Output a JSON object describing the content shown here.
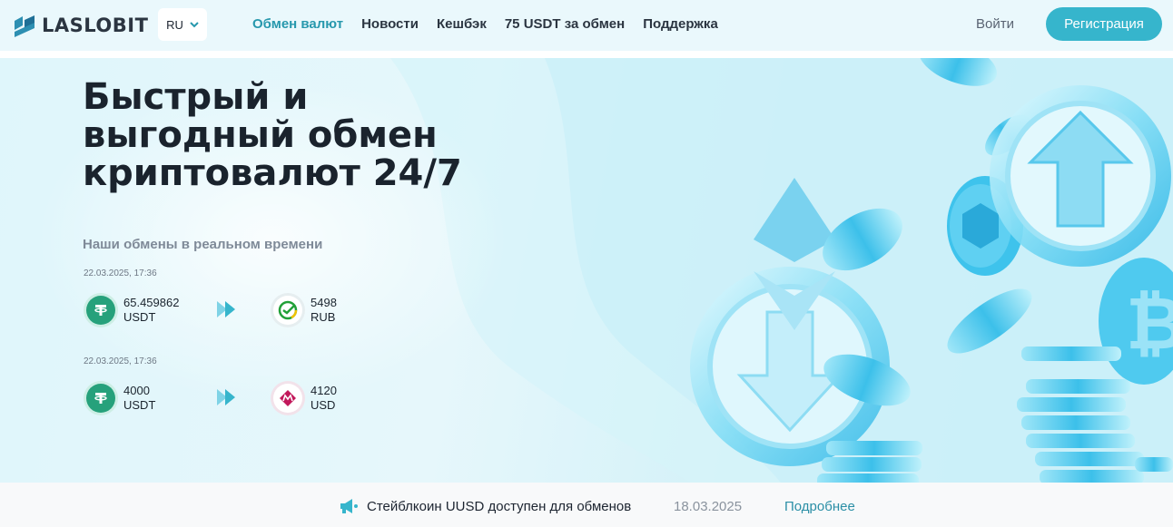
{
  "brand": {
    "name": "LASLOBIT"
  },
  "language": {
    "current": "RU"
  },
  "nav": {
    "items": [
      {
        "label": "Обмен валют",
        "active": true
      },
      {
        "label": "Новости",
        "active": false
      },
      {
        "label": "Кешбэк",
        "active": false
      },
      {
        "label": "75 USDT за обмен",
        "active": false
      },
      {
        "label": "Поддержка",
        "active": false
      }
    ]
  },
  "auth": {
    "login_label": "Войти",
    "register_label": "Регистрация"
  },
  "hero": {
    "title": "Быстрый и выгодный обмен криптовалют 24/7",
    "exchanges_heading": "Наши обмены в реальном времени",
    "exchanges": [
      {
        "date": "22.03.2025, 17:36",
        "from": {
          "amount": "65.459862",
          "currency": "USDT",
          "icon": "tether-icon"
        },
        "to": {
          "amount": "5498",
          "currency": "RUB",
          "icon": "sberbank-icon"
        }
      },
      {
        "date": "22.03.2025, 17:36",
        "from": {
          "amount": "4000",
          "currency": "USDT",
          "icon": "tether-icon"
        },
        "to": {
          "amount": "4120",
          "currency": "USD",
          "icon": "perfect-money-icon"
        }
      }
    ]
  },
  "news_bar": {
    "text": "Стейблкоин UUSD доступен для обменов",
    "date": "18.03.2025",
    "link_label": "Подробнее"
  },
  "colors": {
    "accent": "#36b5cc",
    "nav_active": "#2798ad",
    "tether": "#26a17b",
    "sber": "#21a038",
    "perfect_money": "#c2185b"
  }
}
